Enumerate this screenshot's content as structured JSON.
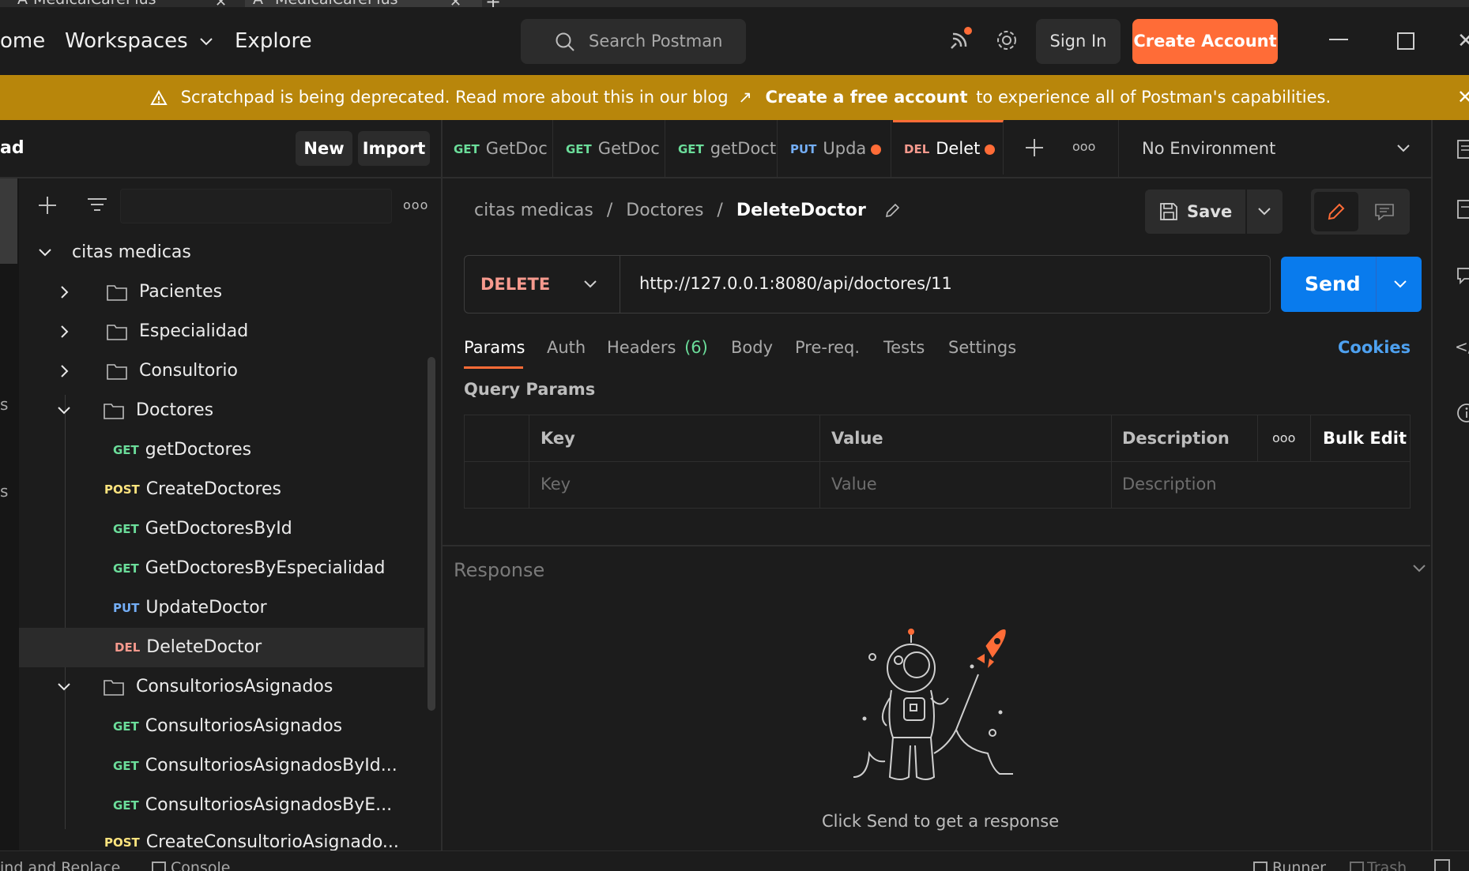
{
  "browser_tabs": [
    {
      "label": "MedicalCarePlus"
    },
    {
      "label": "MedicalCarePlus"
    }
  ],
  "header": {
    "nav_home": "ome",
    "nav_workspaces": "Workspaces",
    "nav_explore": "Explore",
    "search_placeholder": "Search Postman",
    "sign_in": "Sign In",
    "create_account": "Create Account"
  },
  "banner": {
    "message": "Scratchpad is being deprecated. Read more about this in our blog",
    "link_arrow": "↗",
    "cta_bold": "Create a free account",
    "cta_rest": "to experience all of Postman's capabilities."
  },
  "sidebar": {
    "title": "ad",
    "new_label": "New",
    "import_label": "Import",
    "edge_letters": [
      "s",
      "s"
    ],
    "collection": "citas medicas",
    "folders": {
      "pacientes": "Pacientes",
      "especialidad": "Especialidad",
      "consultorio": "Consultorio",
      "doctores": "Doctores",
      "consultorios_asignados": "ConsultoriosAsignados"
    },
    "doctores_requests": [
      {
        "method": "GET",
        "name": "getDoctores"
      },
      {
        "method": "POST",
        "name": "CreateDoctores"
      },
      {
        "method": "GET",
        "name": "GetDoctoresById"
      },
      {
        "method": "GET",
        "name": "GetDoctoresByEspecialidad"
      },
      {
        "method": "PUT",
        "name": "UpdateDoctor"
      },
      {
        "method": "DEL",
        "name": "DeleteDoctor"
      }
    ],
    "asignados_requests": [
      {
        "method": "GET",
        "name": "ConsultoriosAsignados"
      },
      {
        "method": "GET",
        "name": "ConsultoriosAsignadosById..."
      },
      {
        "method": "GET",
        "name": "ConsultoriosAsignadosByE..."
      },
      {
        "method": "POST",
        "name": "CreateConsultorioAsignado..."
      }
    ]
  },
  "request_tabs": [
    {
      "method": "GET",
      "name": "GetDoc"
    },
    {
      "method": "GET",
      "name": "GetDoc"
    },
    {
      "method": "GET",
      "name": "getDoct"
    },
    {
      "method": "PUT",
      "name": "Upda"
    },
    {
      "method": "DEL",
      "name": "Delet"
    }
  ],
  "environment": "No Environment",
  "breadcrumb": {
    "collection": "citas medicas",
    "sep1": "/",
    "folder": "Doctores",
    "sep2": "/",
    "request": "DeleteDoctor"
  },
  "save_label": "Save",
  "request": {
    "method": "DELETE",
    "url": "http://127.0.0.1:8080/api/doctores/11",
    "send_label": "Send"
  },
  "subtabs": {
    "params": "Params",
    "auth": "Auth",
    "headers": "Headers",
    "headers_count": "(6)",
    "body": "Body",
    "prereq": "Pre-req.",
    "tests": "Tests",
    "settings": "Settings",
    "cookies": "Cookies"
  },
  "query_params": {
    "title": "Query Params",
    "col_key": "Key",
    "col_value": "Value",
    "col_description": "Description",
    "bulk_edit": "Bulk Edit",
    "ph_key": "Key",
    "ph_value": "Value",
    "ph_description": "Description"
  },
  "response": {
    "title": "Response",
    "empty_message": "Click Send to get a response"
  },
  "footer": {
    "find_replace": "ind and Replace",
    "console": "Console",
    "runner": "Runner",
    "trash": "Trash"
  },
  "colors": {
    "accent": "#ff6c37",
    "send_blue": "#097bed",
    "banner": "#b8860b",
    "get": "#6bdd9a",
    "post": "#ffe47e",
    "put": "#74aef6",
    "delete": "#f79a8e"
  }
}
